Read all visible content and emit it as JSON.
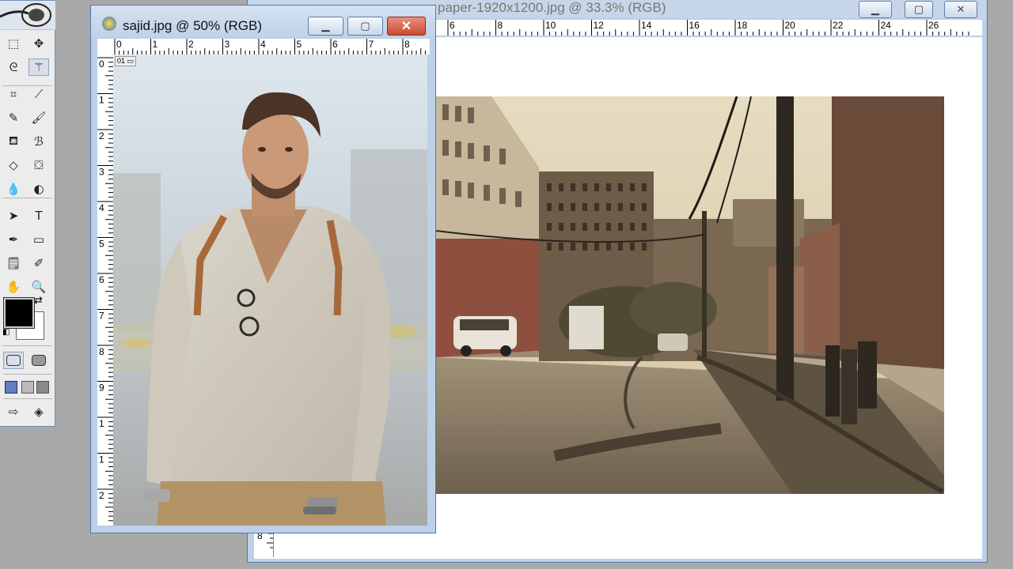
{
  "toolbox": {
    "tools_row1": [
      "marquee-tool",
      "move-tool"
    ],
    "tools": [
      [
        "marquee-icon",
        "move-icon"
      ],
      [
        "lasso-icon",
        "magic-wand-icon"
      ],
      [
        "crop-icon",
        "slice-icon"
      ],
      [
        "healing-brush-icon",
        "brush-icon"
      ],
      [
        "clone-stamp-icon",
        "history-brush-icon"
      ],
      [
        "eraser-icon",
        "paint-bucket-icon"
      ],
      [
        "blur-icon",
        "dodge-icon"
      ],
      [
        "path-selection-icon",
        "type-icon"
      ],
      [
        "pen-icon",
        "shape-icon"
      ],
      [
        "notes-icon",
        "eyedropper-icon"
      ],
      [
        "hand-icon",
        "zoom-icon"
      ]
    ],
    "glyphs": {
      "marquee-icon": "⬚",
      "move-icon": "✥",
      "lasso-icon": "ᘓ",
      "magic-wand-icon": "⚚",
      "crop-icon": "⌗",
      "slice-icon": "⟋",
      "healing-brush-icon": "✎",
      "brush-icon": "🖌",
      "clone-stamp-icon": "⛾",
      "history-brush-icon": "ℬ",
      "eraser-icon": "◇",
      "paint-bucket-icon": "⛋",
      "blur-icon": "💧",
      "dodge-icon": "◐",
      "path-selection-icon": "➤",
      "type-icon": "T",
      "pen-icon": "✒",
      "shape-icon": "▭",
      "notes-icon": "🗒",
      "eyedropper-icon": "✐",
      "hand-icon": "✋",
      "zoom-icon": "🔍"
    },
    "foreground_color": "#000000",
    "background_color": "#ffffff"
  },
  "doc_front": {
    "title": "sajid.jpg @ 50% (RGB)",
    "ruler_top": [
      "0",
      "1",
      "2",
      "3",
      "4",
      "5",
      "6",
      "7",
      "8"
    ],
    "ruler_left": [
      "0",
      "1",
      "2",
      "3",
      "4",
      "5",
      "6",
      "7",
      "8",
      "9",
      "1",
      "1",
      "2"
    ],
    "layer_tag": "01"
  },
  "doc_back": {
    "title": "paper-1920x1200.jpg @ 33.3% (RGB)",
    "ruler_top": [
      "6",
      "8",
      "10",
      "12",
      "14",
      "16",
      "18",
      "20",
      "22",
      "24",
      "26"
    ],
    "ruler_left": [
      "8"
    ]
  },
  "colors": {
    "window_frame": "#bcd0e6",
    "window_border": "#4f79ad",
    "close_button": "#c84a30",
    "workspace": "#a9a9a9"
  }
}
